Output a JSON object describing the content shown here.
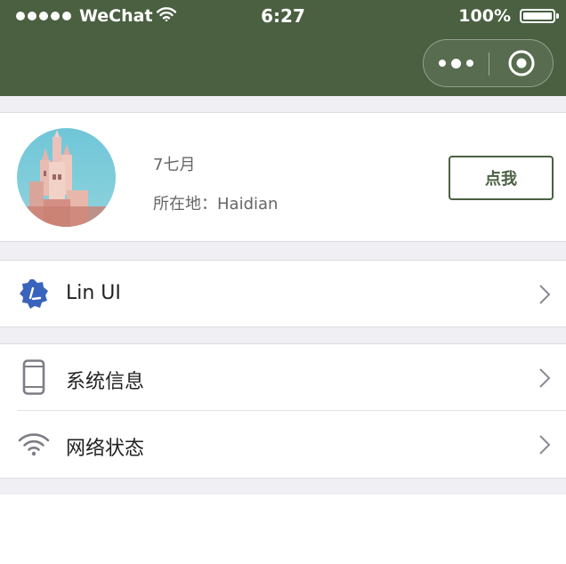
{
  "status_bar": {
    "carrier": "WeChat",
    "time": "6:27",
    "battery": "100%",
    "battery_level": 1.0
  },
  "nav": {
    "more_icon": "more-dots-icon",
    "close_icon": "close-circle-icon",
    "bar_color": "#4a6041"
  },
  "profile": {
    "name": "7七月",
    "location": "所在地：Haidian",
    "button_label": "点我"
  },
  "menu_groups": [
    {
      "items": [
        {
          "label": "Lin UI",
          "icon": "lin-ui-logo-icon"
        }
      ]
    },
    {
      "items": [
        {
          "label": "系统信息",
          "icon": "phone-icon"
        },
        {
          "label": "网络状态",
          "icon": "wifi-icon"
        }
      ]
    }
  ],
  "colors": {
    "accent": "#4a6041",
    "page_bg": "#efeff4",
    "lin_ui_logo": "#3963bc"
  }
}
